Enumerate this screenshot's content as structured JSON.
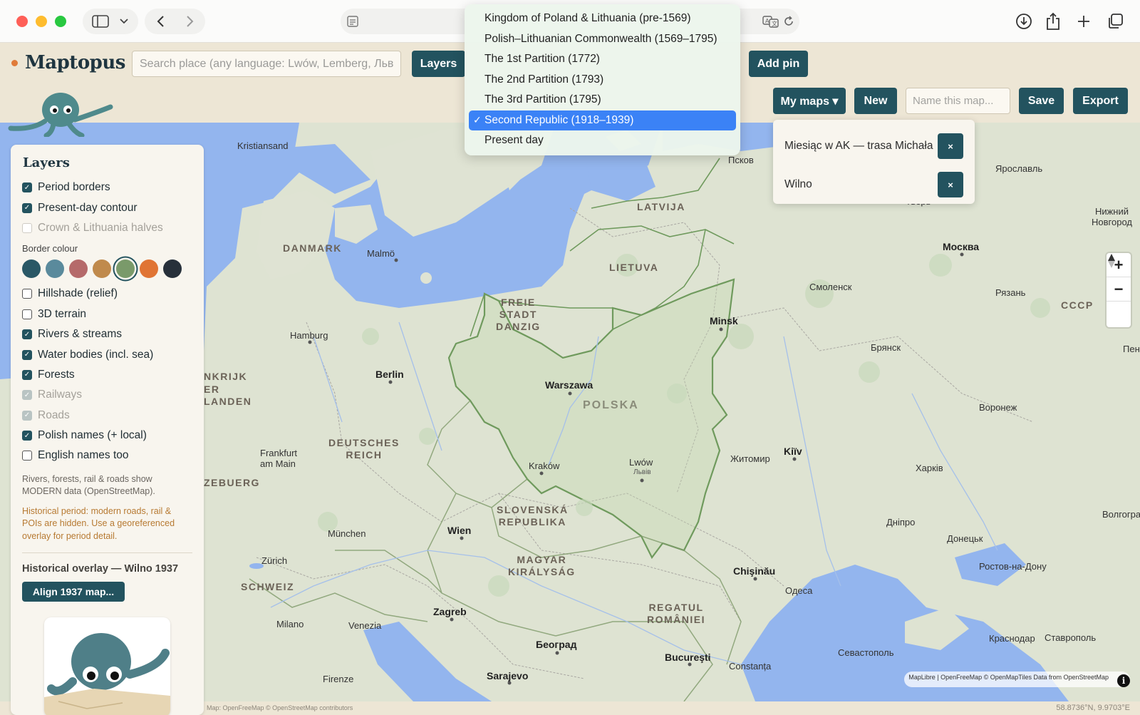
{
  "app": {
    "name": "Maptopus"
  },
  "toolbar": {
    "search_placeholder": "Search place (any language: Lwów, Lemberg, Льв",
    "layers_label": "Layers",
    "add_pin_label": "Add pin",
    "my_maps_label": "My maps ▾",
    "new_label": "New",
    "name_placeholder": "Name this map...",
    "save_label": "Save",
    "export_label": "Export"
  },
  "period_menu": {
    "items": [
      {
        "label": "Kingdom of Poland & Lithuania (pre-1569)",
        "selected": false
      },
      {
        "label": "Polish–Lithuanian Commonwealth (1569–1795)",
        "selected": false
      },
      {
        "label": "The 1st Partition (1772)",
        "selected": false
      },
      {
        "label": "The 2nd Partition (1793)",
        "selected": false
      },
      {
        "label": "The 3rd Partition (1795)",
        "selected": false
      },
      {
        "label": "Second Republic (1918–1939)",
        "selected": true
      },
      {
        "label": "Present day",
        "selected": false
      }
    ],
    "checkmark": "✓"
  },
  "my_maps": {
    "items": [
      {
        "label": "Miesiąc w AK — trasa Michała",
        "delete": "×"
      },
      {
        "label": "Wilno",
        "delete": "×"
      }
    ]
  },
  "layers": {
    "title": "Layers",
    "group1": [
      {
        "label": "Period borders",
        "checked": true,
        "disabled": false
      },
      {
        "label": "Present-day contour",
        "checked": true,
        "disabled": false
      },
      {
        "label": "Crown & Lithuania halves",
        "checked": false,
        "disabled": true
      }
    ],
    "border_colour_label": "Border colour",
    "swatches": [
      "#2a5866",
      "#5a8a9c",
      "#b56a6a",
      "#c08a4c",
      "#7a9a6a",
      "#e07434",
      "#27303a"
    ],
    "selected_swatch": 4,
    "group2": [
      {
        "label": "Hillshade (relief)",
        "checked": false,
        "disabled": false
      },
      {
        "label": "3D terrain",
        "checked": false,
        "disabled": false
      },
      {
        "label": "Rivers & streams",
        "checked": true,
        "disabled": false
      },
      {
        "label": "Water bodies (incl. sea)",
        "checked": true,
        "disabled": false
      },
      {
        "label": "Forests",
        "checked": true,
        "disabled": false
      },
      {
        "label": "Railways",
        "checked": true,
        "disabled": true
      },
      {
        "label": "Roads",
        "checked": true,
        "disabled": true
      },
      {
        "label": "Polish names (+ local)",
        "checked": true,
        "disabled": false
      },
      {
        "label": "English names too",
        "checked": false,
        "disabled": false
      }
    ],
    "note_modern": "Rivers, forests, rail & roads show MODERN data (OpenStreetMap).",
    "note_historical": "Historical period: modern roads, rail & POIs are hidden. Use a georeferenced overlay for period detail.",
    "overlay_title": "Historical overlay — Wilno 1937",
    "align_label": "Align 1937 map..."
  },
  "map": {
    "countries": [
      {
        "text": "DANMARK"
      },
      {
        "text": "LATVIJA"
      },
      {
        "text": "LIETUVA"
      },
      {
        "text": "FREIE\nSTADT\nDANZIG"
      },
      {
        "text": "POLSKA"
      },
      {
        "text": "DEUTSCHES\nREICH"
      },
      {
        "text": "SLOVENSKÁ\nREPUBLIKA"
      },
      {
        "text": "MAGYAR\nKIRÁLYSÁG"
      },
      {
        "text": "REGATUL\nROMÂNIEI"
      },
      {
        "text": "SCHWEIZ"
      },
      {
        "text": "СССР"
      },
      {
        "text": "NKRIJK"
      },
      {
        "text": "ER"
      },
      {
        "text": "LANDEN"
      },
      {
        "text": "ZEBUERG"
      }
    ],
    "cities_major": [
      "Warszawa",
      "Berlin",
      "Москва",
      "Minsk",
      "Kiïv",
      "Chişinău",
      "Wien",
      "Zagreb",
      "Београд",
      "Bucureşti",
      "Sarajevo"
    ],
    "cities_minor": [
      "Kristiansand",
      "Malmö",
      "Hamburg",
      "Frankfurt\nam Main",
      "München",
      "Zürich",
      "Milano",
      "Venezia",
      "Firenze",
      "Kraków",
      "Lwów",
      "Львів",
      "Псков",
      "Тверь",
      "Ярославль",
      "Нижний\nНовгород",
      "Смоленск",
      "Рязань",
      "Брянск",
      "Воронеж",
      "Житомир",
      "Харків",
      "Дніпро",
      "Донецьк",
      "Волгоград",
      "Ростов-на-Дону",
      "Одеса",
      "Севастополь",
      "Краснодар",
      "Ставрополь",
      "Constanța",
      "Пен"
    ],
    "attribution": "MapLibre | OpenFreeMap © OpenMapTiles Data from OpenStreetMap",
    "footer_attribution": "Map: OpenFreeMap © OpenStreetMap contributors",
    "coordinates": "58.8736°N, 9.9703°E"
  },
  "colors": {
    "accent": "#23535f",
    "water": "#92b6f0",
    "land": "#dfe4d3",
    "border": "#6f9a5d"
  }
}
